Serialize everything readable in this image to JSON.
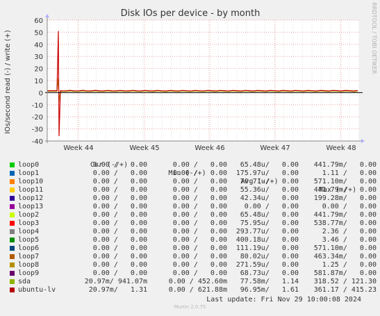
{
  "chart_data": {
    "type": "line",
    "title": "Disk IOs per device - by month",
    "ylabel": "IOs/second read (-) / write (+)",
    "ylim": [
      -40,
      60
    ],
    "yticks": [
      60,
      50,
      40,
      30,
      20,
      10,
      0,
      -10,
      -20,
      -30,
      -40
    ],
    "xticks": [
      "Week 44",
      "Week 45",
      "Week 46",
      "Week 47",
      "Week 48"
    ],
    "grid": true,
    "series": [
      {
        "name": "sda",
        "color": "#98a70b",
        "spike_write": 12,
        "spike_read": -7,
        "baseline_write": 1.14,
        "baseline_read": 0.0
      },
      {
        "name": "ubuntu-lv",
        "color": "#cc0000",
        "spike_write": 51,
        "spike_read": -36,
        "baseline_write": 1.61,
        "baseline_read": 0.0
      }
    ]
  },
  "side_text": "RRDTOOL / TOBI OETIKER",
  "legend": {
    "headers": {
      "cur": "Cur (-/+)",
      "min": "Min (-/+)",
      "avg": "Avg (-/+)",
      "max": "Max (-/+)"
    },
    "rows": [
      {
        "name": "loop0",
        "color": "#00cc00",
        "cur": "0.00 /   0.00",
        "min": "0.00 /   0.00",
        "avg": "65.48u/   0.00",
        "max": "441.79m/   0.00"
      },
      {
        "name": "loop1",
        "color": "#0066b3",
        "cur": "0.00 /   0.00",
        "min": "0.00 /   0.00",
        "avg": "175.97u/   0.00",
        "max": "1.11 /   0.00"
      },
      {
        "name": "loop10",
        "color": "#ff8000",
        "cur": "0.00 /   0.00",
        "min": "0.00 /   0.00",
        "avg": "70.71u/   0.00",
        "max": "571.10m/   0.00"
      },
      {
        "name": "loop11",
        "color": "#ffcc00",
        "cur": "0.00 /   0.00",
        "min": "0.00 /   0.00",
        "avg": "55.36u/   0.00",
        "max": "441.79m/   0.00"
      },
      {
        "name": "loop12",
        "color": "#330099",
        "cur": "0.00 /   0.00",
        "min": "0.00 /   0.00",
        "avg": "42.34u/   0.00",
        "max": "199.28m/   0.00"
      },
      {
        "name": "loop13",
        "color": "#990099",
        "cur": "0.00 /   0.00",
        "min": "0.00 /   0.00",
        "avg": "0.00 /   0.00",
        "max": "0.00 /   0.00"
      },
      {
        "name": "loop2",
        "color": "#ccff00",
        "cur": "0.00 /   0.00",
        "min": "0.00 /   0.00",
        "avg": "65.48u/   0.00",
        "max": "441.79m/   0.00"
      },
      {
        "name": "loop3",
        "color": "#ff0000",
        "cur": "0.00 /   0.00",
        "min": "0.00 /   0.00",
        "avg": "75.95u/   0.00",
        "max": "538.77m/   0.00"
      },
      {
        "name": "loop4",
        "color": "#808080",
        "cur": "0.00 /   0.00",
        "min": "0.00 /   0.00",
        "avg": "293.77u/   0.00",
        "max": "2.36 /   0.00"
      },
      {
        "name": "loop5",
        "color": "#008f00",
        "cur": "0.00 /   0.00",
        "min": "0.00 /   0.00",
        "avg": "400.18u/   0.00",
        "max": "3.46 /   0.00"
      },
      {
        "name": "loop6",
        "color": "#00487d",
        "cur": "0.00 /   0.00",
        "min": "0.00 /   0.00",
        "avg": "111.19u/   0.00",
        "max": "571.10m/   0.00"
      },
      {
        "name": "loop7",
        "color": "#b35a00",
        "cur": "0.00 /   0.00",
        "min": "0.00 /   0.00",
        "avg": "80.02u/   0.00",
        "max": "463.34m/   0.00"
      },
      {
        "name": "loop8",
        "color": "#b38f00",
        "cur": "0.00 /   0.00",
        "min": "0.00 /   0.00",
        "avg": "271.59u/   0.00",
        "max": "1.25 /   0.00"
      },
      {
        "name": "loop9",
        "color": "#6b006b",
        "cur": "0.00 /   0.00",
        "min": "0.00 /   0.00",
        "avg": "68.73u/   0.00",
        "max": "581.87m/   0.00"
      },
      {
        "name": "sda",
        "color": "#8fb300",
        "cur": "20.97m/ 941.07m",
        "min": "0.00 / 452.60m",
        "avg": "77.58m/   1.14",
        "max": "318.52 / 121.30"
      },
      {
        "name": "ubuntu-lv",
        "color": "#b30000",
        "cur": "20.97m/   1.31",
        "min": "0.00 / 621.88m",
        "avg": "96.95m/   1.61",
        "max": "361.17 / 415.23"
      }
    ]
  },
  "last_update": "Last update: Fri Nov 29 10:00:08 2024",
  "footer": "Munin 2.0.75"
}
